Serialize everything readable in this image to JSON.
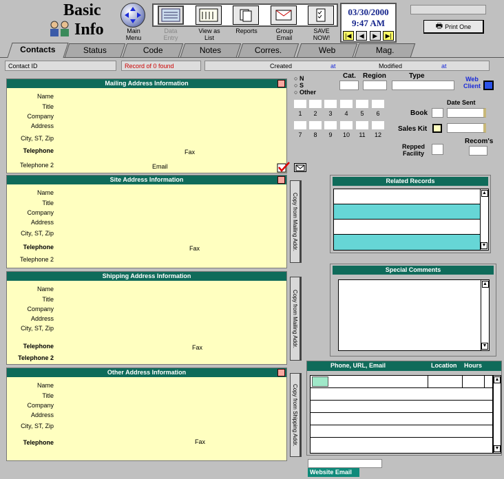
{
  "brand": {
    "line1": "Basic",
    "line2": "Info"
  },
  "nav": {
    "main_menu": "Main\nMenu"
  },
  "toolbar": {
    "data_entry": "Data\nEntry",
    "view_list": "View as\nList",
    "reports": "Reports",
    "group_email": "Group\nEmail",
    "save_now": "SAVE\nNOW!"
  },
  "datetime": {
    "date": "03/30/2000",
    "time": "9:47 AM"
  },
  "print_one": "Print One",
  "tabs": [
    "Contacts",
    "Status",
    "Code",
    "Notes",
    "Corres.",
    "Web",
    "Mag."
  ],
  "infobar": {
    "contact_id": "Contact ID",
    "record_status": "Record of 0 found",
    "created": "Created",
    "at1": "at",
    "modified": "Modified",
    "at2": "at"
  },
  "mailing": {
    "title": "Mailing Address Information",
    "name": "Name",
    "title_lbl": "Title",
    "company": "Company",
    "address": "Address",
    "city": "City, ST, Zip",
    "telephone": "Telephone",
    "fax": "Fax",
    "telephone2": "Telephone 2",
    "email": "Email"
  },
  "site": {
    "title": "Site Address Information",
    "name": "Name",
    "title_lbl": "Title",
    "company": "Company",
    "address": "Address",
    "city": "City, ST, Zip",
    "telephone": "Telephone",
    "fax": "Fax",
    "telephone2": "Telephone 2",
    "copy": "Copy from Mailing Addr."
  },
  "shipping": {
    "title": "Shipping Address Information",
    "name": "Name",
    "title_lbl": "Title",
    "company": "Company",
    "address": "Address",
    "city": "City, ST, Zip",
    "telephone": "Telephone",
    "fax": "Fax",
    "telephone2": "Telephone 2",
    "copy": "Copy from Mailing Addr."
  },
  "other": {
    "title": "Other Address Information",
    "name": "Name",
    "title_lbl": "Title",
    "company": "Company",
    "address": "Address",
    "city": "City, ST, Zip",
    "telephone": "Telephone",
    "fax": "Fax",
    "copy": "Copy from Shipping Addr."
  },
  "nso": {
    "n": "N",
    "s": "S",
    "other": "Other"
  },
  "cat": "Cat.",
  "region": "Region",
  "type": "Type",
  "web_client": "Web\nClient",
  "numbers": [
    "1",
    "2",
    "3",
    "4",
    "5",
    "6",
    "7",
    "8",
    "9",
    "10",
    "11",
    "12"
  ],
  "date_sent": "Date Sent",
  "book": "Book",
  "sales_kit": "Sales Kit",
  "repped": "Repped\nFacility",
  "recoms": "Recom's",
  "related": {
    "title": "Related Records"
  },
  "special": {
    "title": "Special Comments"
  },
  "phone": {
    "col1": "Phone, URL, Email",
    "col2": "Location",
    "col3": "Hours"
  },
  "website_email": "Website Email",
  "colors": {
    "header": "#0f6b5a",
    "section_bg": "#ffffc0",
    "teal_row": "#66d6d6",
    "accent_blue": "#1a2ad8"
  }
}
